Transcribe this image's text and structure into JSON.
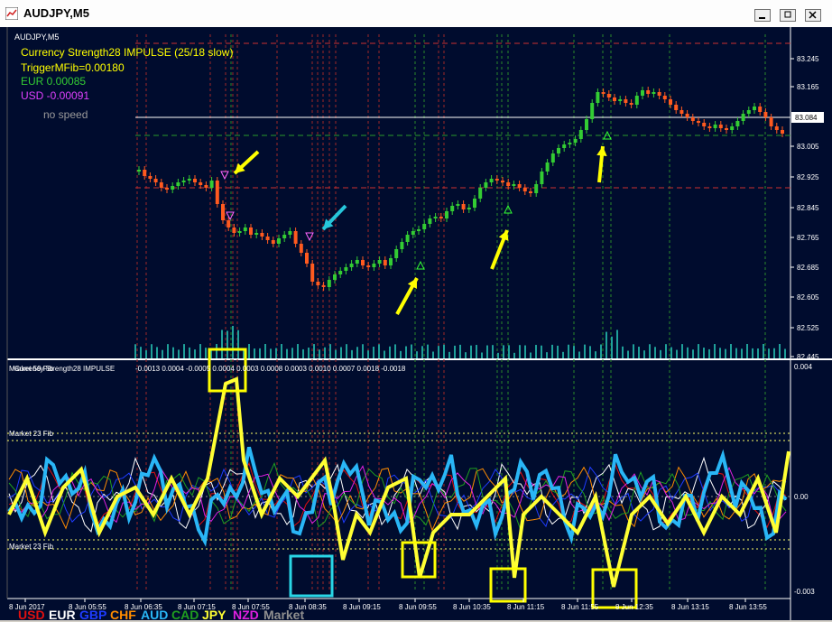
{
  "window": {
    "title": "AUDJPY,M5"
  },
  "main": {
    "symbol_label": "AUDJPY,M5",
    "indicator_name": "Currency Strength28 IMPULSE (25/18 slow)",
    "trigger": "TriggerMFib=0.00180",
    "eur": "EUR 0.00085",
    "usd": "USD -0.00091",
    "speed": "no speed",
    "current_price": "83.084",
    "price_ticks": [
      "83.245",
      "83.165",
      "83.005",
      "82.925",
      "82.845",
      "82.765",
      "82.685",
      "82.605",
      "82.525",
      "82.445"
    ]
  },
  "sub": {
    "header": "Currency Strength28 IMPULSE",
    "values": "-0.0013 0.0004 -0.0005 0.0004 0.0003 0.0008 0.0003 0.0010 0.0007 0.0018 -0.0018",
    "market_label": "Market 59 Fib",
    "fib_upper": "Market 23 Fib",
    "fib_lower": "Market 23 Fib",
    "ticks": [
      "0.004",
      "0.00",
      "-0.003"
    ],
    "legend": [
      {
        "label": "USD",
        "color": "#e01010"
      },
      {
        "label": "EUR",
        "color": "#ffffff"
      },
      {
        "label": "GBP",
        "color": "#1e3cff"
      },
      {
        "label": "CHF",
        "color": "#ff8c00"
      },
      {
        "label": "AUD",
        "color": "#29b6f6"
      },
      {
        "label": "CAD",
        "color": "#1f9e1f"
      },
      {
        "label": "JPY",
        "color": "#ffff33"
      },
      {
        "label": "NZD",
        "color": "#e020e0"
      },
      {
        "label": "Market",
        "color": "#909090"
      }
    ]
  },
  "time_axis": [
    "8 Jun 2017",
    "8 Jun 05:55",
    "8 Jun 06:35",
    "8 Jun 07:15",
    "8 Jun 07:55",
    "8 Jun 08:35",
    "8 Jun 09:15",
    "8 Jun 09:55",
    "8 Jun 10:35",
    "8 Jun 11:15",
    "8 Jun 11:55",
    "8 Jun 12:35",
    "8 Jun 13:15",
    "8 Jun 13:55"
  ],
  "colors": {
    "background": "#000c2e",
    "bull": "#33cc33",
    "bear": "#ff5a1f",
    "arrow_yellow": "#ffff00",
    "arrow_cyan": "#26c6da"
  }
}
